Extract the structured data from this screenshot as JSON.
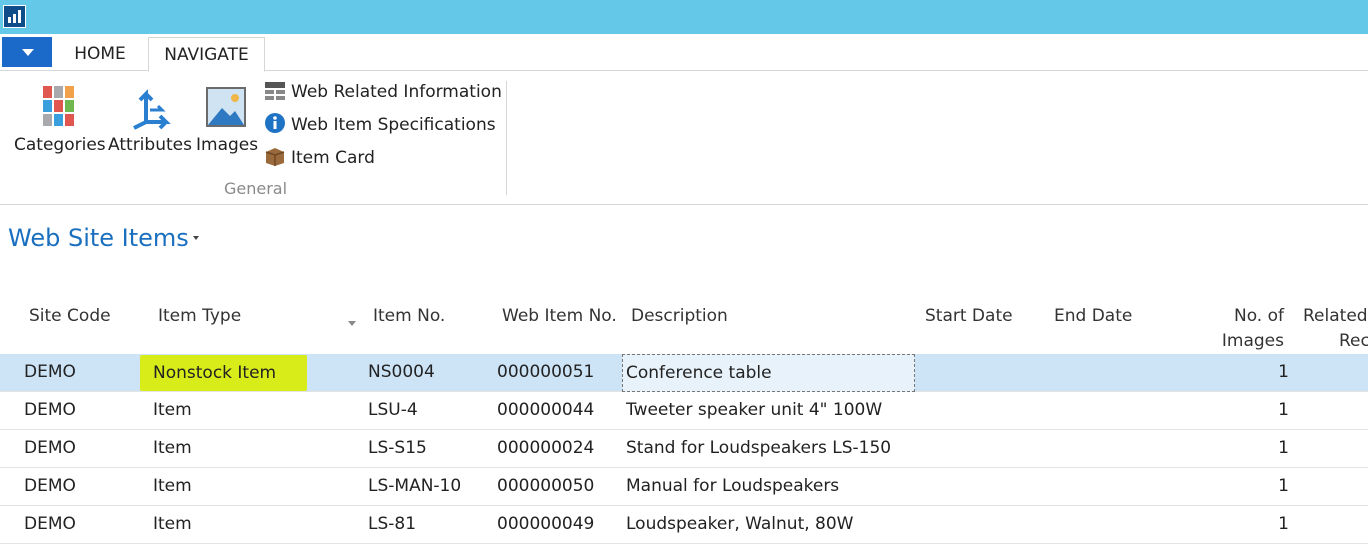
{
  "ribbon": {
    "tabs": {
      "home": "HOME",
      "navigate": "NAVIGATE"
    },
    "buttons": {
      "categories": "Categories",
      "attributes": "Attributes",
      "images": "Images",
      "web_related_information": "Web Related Information",
      "web_item_specifications": "Web Item Specifications",
      "item_card": "Item Card"
    },
    "group_label": "General"
  },
  "page": {
    "title": "Web Site Items"
  },
  "table": {
    "columns": {
      "site_code": "Site Code",
      "item_type": "Item Type",
      "item_no": "Item No.",
      "web_item_no": "Web Item No.",
      "description": "Description",
      "start_date": "Start Date",
      "end_date": "End Date",
      "no_of_images_1": "No. of",
      "no_of_images_2": "Images",
      "related_1": "Related",
      "related_2": "Rec"
    },
    "rows": [
      {
        "site_code": "DEMO",
        "item_type": "Nonstock Item",
        "item_no": "NS0004",
        "web_item_no": "000000051",
        "description": "Conference table",
        "start_date": "",
        "end_date": "",
        "no_of_images": "1"
      },
      {
        "site_code": "DEMO",
        "item_type": "Item",
        "item_no": "LSU-4",
        "web_item_no": "000000044",
        "description": "Tweeter speaker unit 4\" 100W",
        "start_date": "",
        "end_date": "",
        "no_of_images": "1"
      },
      {
        "site_code": "DEMO",
        "item_type": "Item",
        "item_no": "LS-S15",
        "web_item_no": "000000024",
        "description": "Stand for Loudspeakers LS-150",
        "start_date": "",
        "end_date": "",
        "no_of_images": "1"
      },
      {
        "site_code": "DEMO",
        "item_type": "Item",
        "item_no": "LS-MAN-10",
        "web_item_no": "000000050",
        "description": "Manual for Loudspeakers",
        "start_date": "",
        "end_date": "",
        "no_of_images": "1"
      },
      {
        "site_code": "DEMO",
        "item_type": "Item",
        "item_no": "LS-81",
        "web_item_no": "000000049",
        "description": "Loudspeaker, Walnut, 80W",
        "start_date": "",
        "end_date": "",
        "no_of_images": "1"
      }
    ]
  },
  "colors": {
    "titlebar": "#64c8e9",
    "accent_blue": "#1a6fbf",
    "selected_row": "#cde4f7",
    "highlighter": "#d8ec19"
  }
}
